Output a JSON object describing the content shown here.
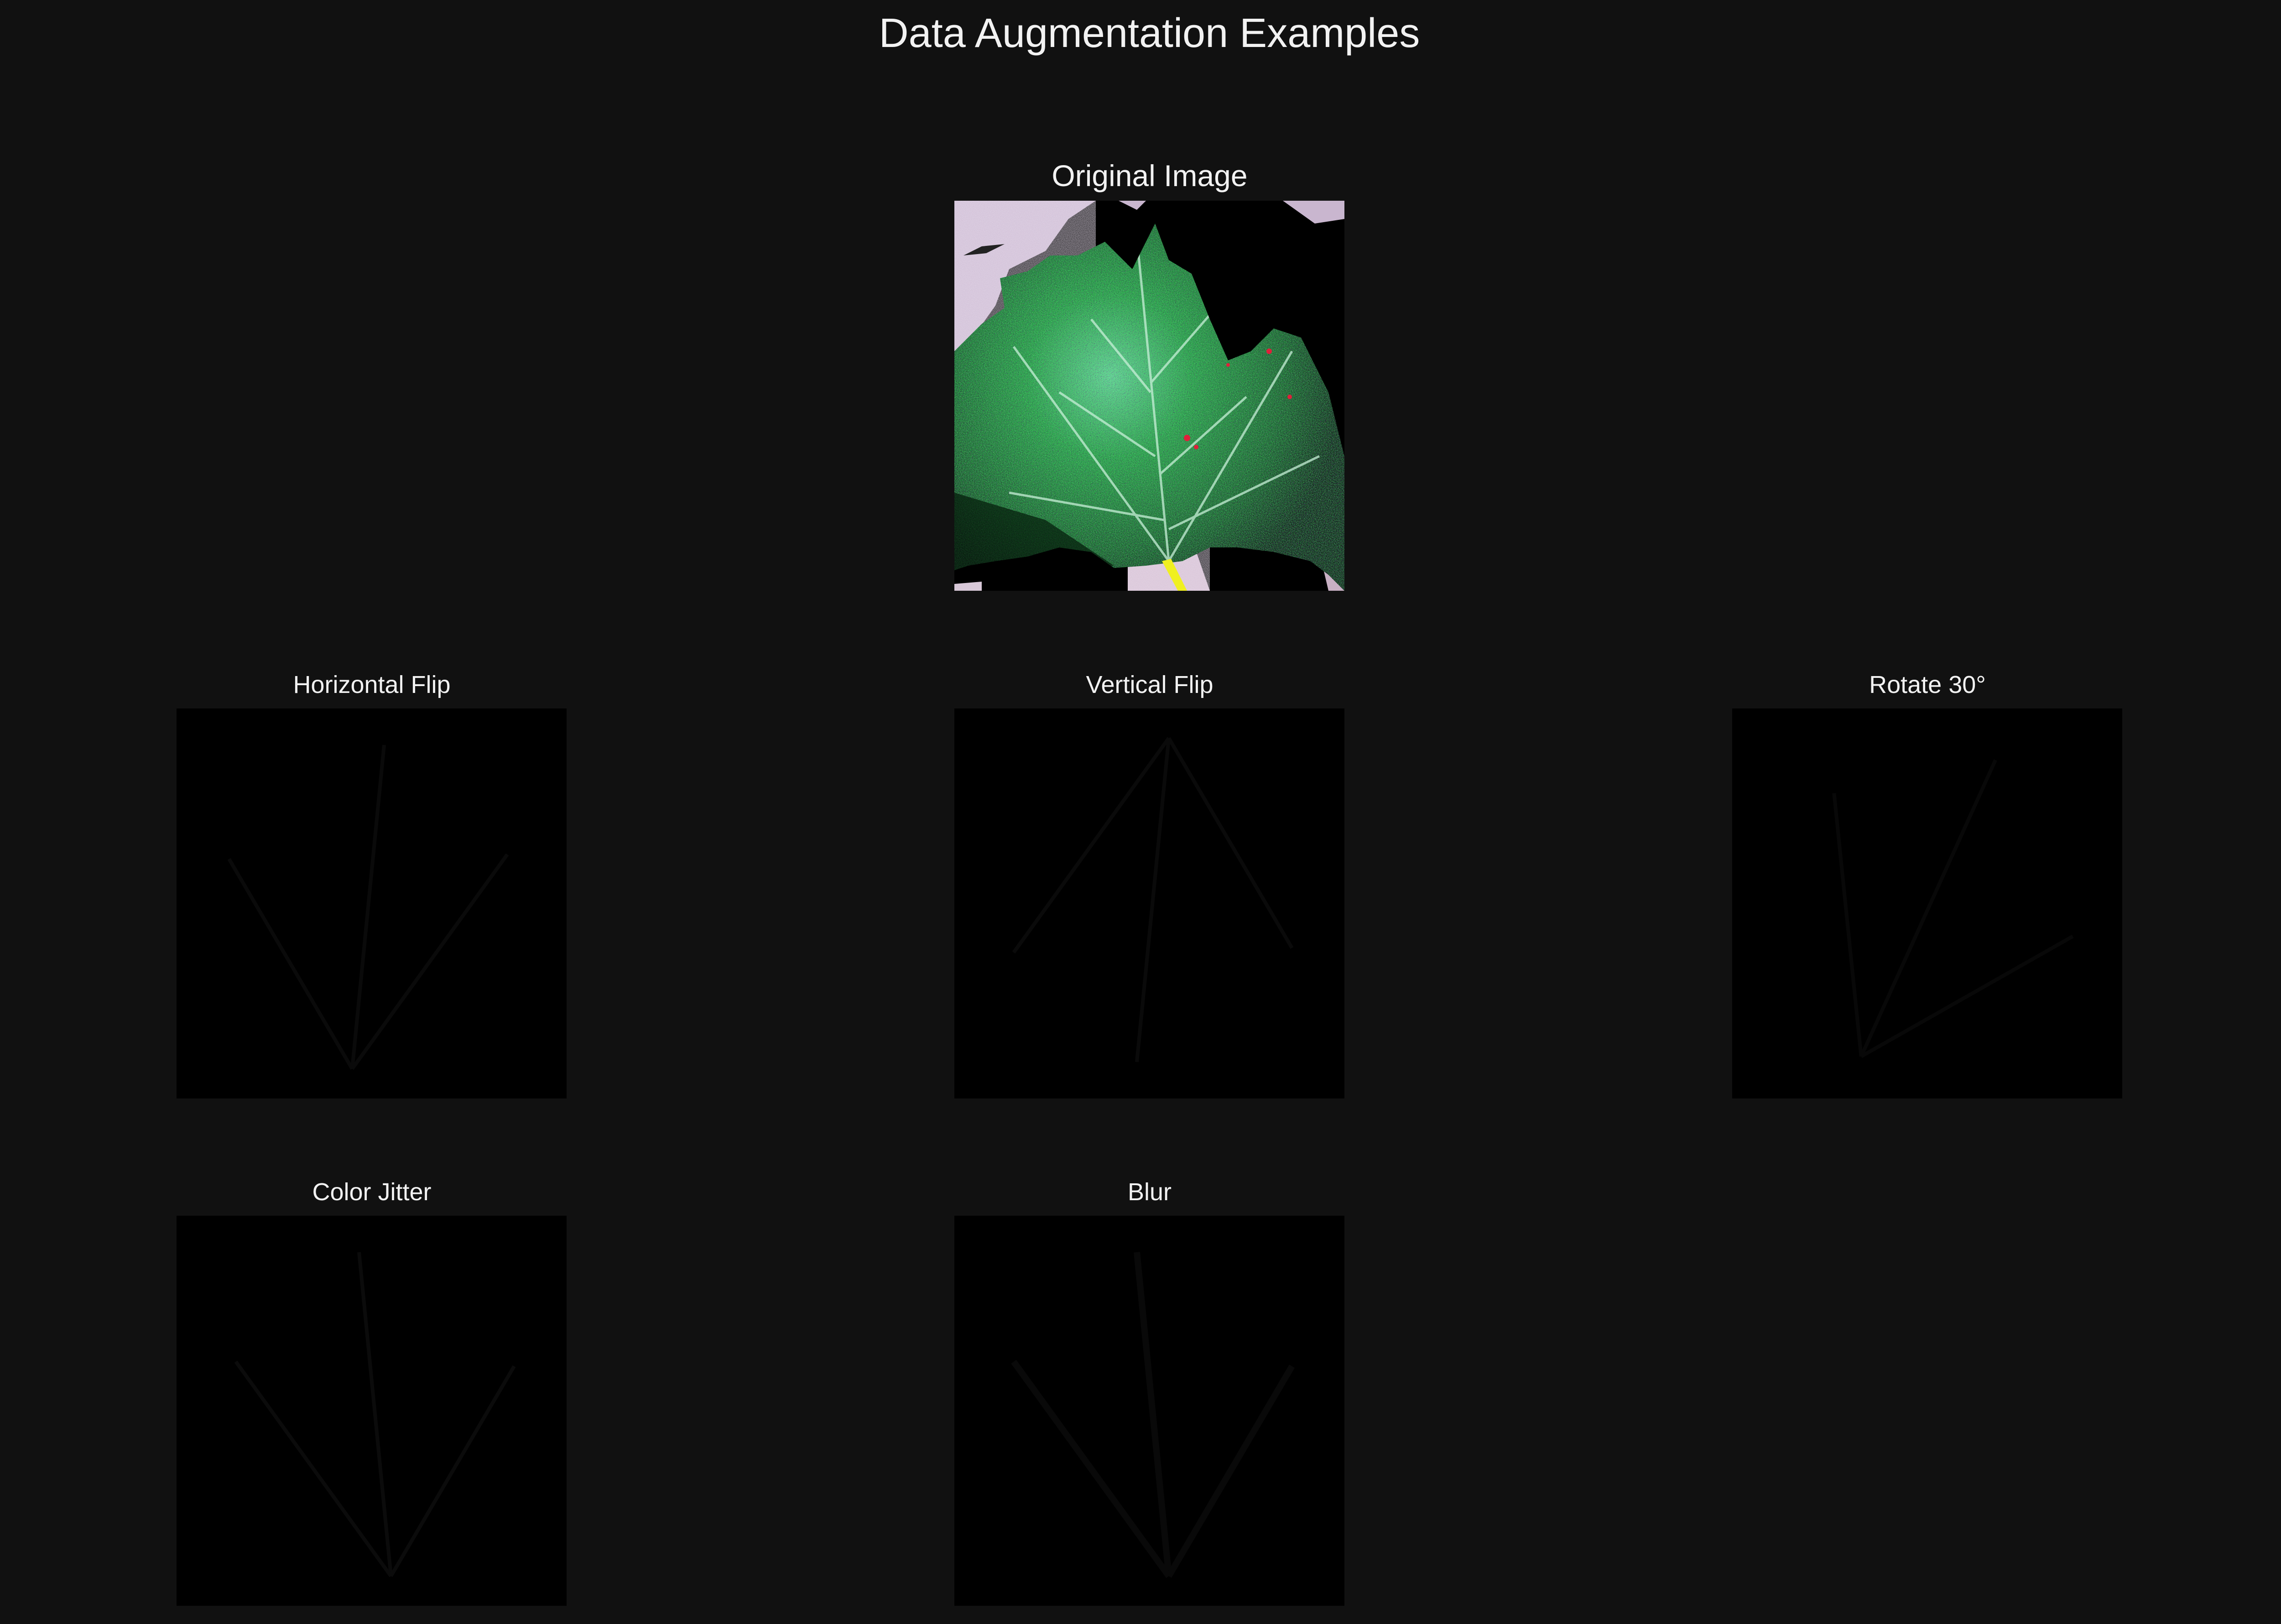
{
  "figure": {
    "title": "Data Augmentation Examples"
  },
  "panels": {
    "original": {
      "title": "Original Image"
    },
    "hflip": {
      "title": "Horizontal Flip"
    },
    "vflip": {
      "title": "Vertical Flip"
    },
    "rotate": {
      "title": "Rotate 30°"
    },
    "jitter": {
      "title": "Color Jitter"
    },
    "blur": {
      "title": "Blur"
    }
  },
  "colors": {
    "figure_background": "#111111",
    "title_text": "#f2f2f2",
    "image_background": "#000000",
    "leaf_green": "#1e8a35",
    "background_lavender": "#c9b6cf"
  }
}
